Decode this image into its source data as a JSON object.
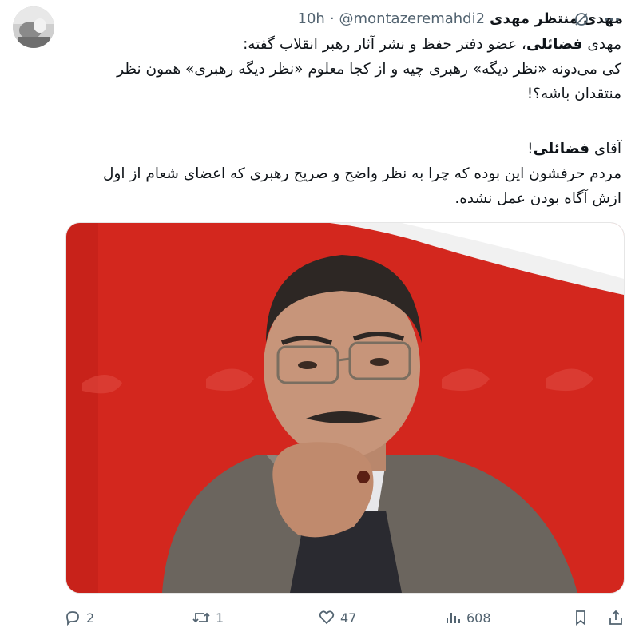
{
  "author": {
    "name": "مهدی منتظر مهدی",
    "handle": "@montazeremahdi2",
    "separator": "·",
    "time": "10h"
  },
  "body": {
    "p1_name": "فضائلی",
    "p1_prefix": "مهدی ",
    "p1_rest": "، عضو دفتر حفظ و نشر آثار رهبر انقلاب گفته:",
    "p2": "کی می‌دونه «نظر دیگه» رهبری چیه و از کجا معلوم «نظر دیگه رهبری» همون نظر منتقدان باشه؟!",
    "p3_prefix": "آقای ",
    "p3_name": "فضائلی",
    "p3_suffix": "!",
    "p4": "مردم حرفشون این بوده که چرا به نظر واضح و صریح رهبری که اعضای شعام از اول ازش آگاه بودن عمل نشده."
  },
  "actions": {
    "replies": "2",
    "reposts": "1",
    "likes": "47",
    "views": "608"
  },
  "icons": [
    "grok-icon",
    "more-icon",
    "reply-icon",
    "repost-icon",
    "like-icon",
    "views-icon",
    "bookmark-icon",
    "share-icon"
  ],
  "colors": {
    "text": "#0f1419",
    "muted": "#536471",
    "photo_red": "#d3271e"
  }
}
